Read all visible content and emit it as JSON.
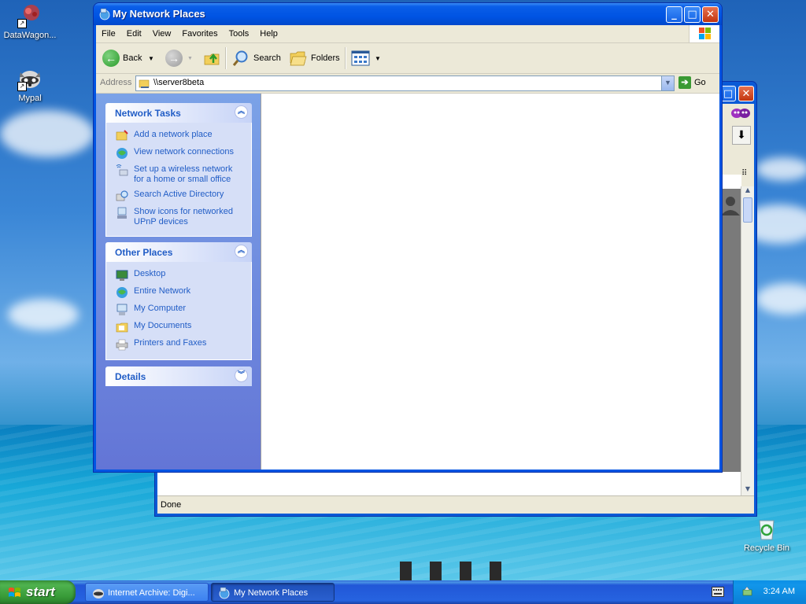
{
  "window": {
    "title": "My Network Places",
    "buttons": {
      "minimize": "_",
      "maximize": "□",
      "close": "✕"
    }
  },
  "menu": [
    "File",
    "Edit",
    "View",
    "Favorites",
    "Tools",
    "Help"
  ],
  "toolbar": {
    "back": "Back",
    "search": "Search",
    "folders": "Folders"
  },
  "address": {
    "label": "Address",
    "value": "\\\\server8beta",
    "go": "Go"
  },
  "network_tasks": {
    "title": "Network Tasks",
    "items": [
      {
        "label": "Add a network place",
        "icon": "add-network-place-icon"
      },
      {
        "label": "View network connections",
        "icon": "network-connections-icon"
      },
      {
        "label": "Set up a wireless network\nfor a home or small office",
        "icon": "wireless-network-icon"
      },
      {
        "label": "Search Active Directory",
        "icon": "active-directory-icon"
      },
      {
        "label": "Show icons for networked\nUPnP devices",
        "icon": "upnp-devices-icon"
      }
    ]
  },
  "other_places": {
    "title": "Other Places",
    "items": [
      {
        "label": "Desktop",
        "icon": "desktop-icon"
      },
      {
        "label": "Entire Network",
        "icon": "entire-network-icon"
      },
      {
        "label": "My Computer",
        "icon": "my-computer-icon"
      },
      {
        "label": "My Documents",
        "icon": "my-documents-icon"
      },
      {
        "label": "Printers and Faxes",
        "icon": "printers-faxes-icon"
      }
    ]
  },
  "details": {
    "title": "Details"
  },
  "desktop_icons": [
    {
      "label": "DataWagon...",
      "icon": "datawagon-icon"
    },
    {
      "label": "Mypal",
      "icon": "mypal-icon"
    },
    {
      "label": "Recycle Bin",
      "icon": "recycle-bin-icon"
    }
  ],
  "back_window": {
    "status": "Done"
  },
  "taskbar": {
    "start": "start",
    "tasks": [
      {
        "label": "Internet Archive: Digi...",
        "active": false
      },
      {
        "label": "My Network Places",
        "active": true
      }
    ],
    "clock": "3:24 AM"
  },
  "colors": {
    "xp_blue": "#0054e3",
    "task_link": "#215dc6",
    "start_green": "#379a37"
  }
}
